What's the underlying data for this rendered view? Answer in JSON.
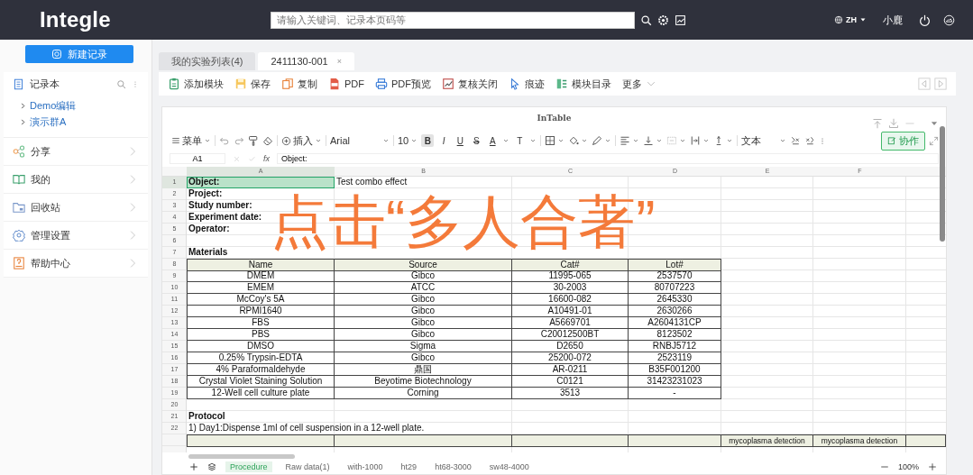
{
  "header": {
    "logo": "Integle",
    "search": {
      "placeholder": "请输入关键词、记录本页码等"
    },
    "language": "ZH",
    "user": "小鹿"
  },
  "sidebar": {
    "new_button": "新建记录",
    "notebook": {
      "title": "记录本",
      "children": [
        {
          "label": "Demo编辑",
          "expanded": false
        },
        {
          "label": "演示群A",
          "expanded": false
        }
      ]
    },
    "items": [
      {
        "label": "分享"
      },
      {
        "label": "我的"
      },
      {
        "label": "回收站"
      },
      {
        "label": "管理设置"
      },
      {
        "label": "帮助中心"
      }
    ]
  },
  "tabs": [
    {
      "label": "我的实验列表(4)",
      "selected": false
    },
    {
      "label": "2411130-001",
      "selected": true,
      "close": "×"
    }
  ],
  "toolbar": {
    "items": [
      "添加模块",
      "保存",
      "复制",
      "PDF",
      "PDF预览",
      "复核关闭",
      "痕迹",
      "模块目录"
    ],
    "more": "更多"
  },
  "sheet": {
    "title": "InTable",
    "menu": "菜单",
    "insert": "插入",
    "font": "Arial",
    "size": "10",
    "format_buttons": [
      {
        "label": "B",
        "kind": "bold",
        "selected": true
      },
      {
        "label": "I",
        "kind": "italic",
        "selected": false
      },
      {
        "label": "U",
        "kind": "underline",
        "selected": false
      },
      {
        "label": "S",
        "kind": "strike",
        "selected": false
      },
      {
        "label": "A",
        "kind": "color",
        "selected": false
      },
      {
        "label": "T",
        "kind": "size",
        "selected": false
      }
    ],
    "number_format": "文本",
    "collaborate": "协作",
    "name_box": "A1",
    "fx": "fx",
    "formula": "Object:",
    "columns": [
      {
        "label": "A",
        "selected": true
      },
      {
        "label": "B",
        "selected": false
      },
      {
        "label": "C",
        "selected": false
      },
      {
        "label": "D",
        "selected": false
      },
      {
        "label": "E",
        "selected": false
      },
      {
        "label": "F",
        "selected": false
      }
    ],
    "rows": [
      {
        "number": "1",
        "kind": "field",
        "selected": true,
        "cells": {
          "a": "Object:",
          "b": "Test combo effect"
        }
      },
      {
        "number": "2",
        "kind": "field",
        "selected": false,
        "cells": {
          "a": "Project:"
        }
      },
      {
        "number": "3",
        "kind": "field",
        "selected": false,
        "cells": {
          "a": "Study number:"
        }
      },
      {
        "number": "4",
        "kind": "field",
        "selected": false,
        "cells": {
          "a": "Experiment date:"
        }
      },
      {
        "number": "5",
        "kind": "field",
        "selected": false,
        "cells": {
          "a": "Operator:"
        }
      },
      {
        "number": "6",
        "kind": "blank",
        "selected": false
      },
      {
        "number": "7",
        "kind": "section",
        "selected": false,
        "cells": {
          "a": "Materials"
        }
      },
      {
        "number": "8",
        "kind": "header",
        "selected": false,
        "cells": {
          "a": "Name",
          "b": "Source",
          "c": "Cat#",
          "d": "Lot#"
        }
      },
      {
        "number": "9",
        "kind": "table",
        "selected": false,
        "cells": {
          "a": "DMEM",
          "b": "Gibco",
          "c": "11995-065",
          "d": "2537570"
        }
      },
      {
        "number": "10",
        "kind": "table",
        "selected": false,
        "cells": {
          "a": "EMEM",
          "b": "ATCC",
          "c": "30-2003",
          "d": "80707223"
        }
      },
      {
        "number": "11",
        "kind": "table",
        "selected": false,
        "cells": {
          "a": "McCoy's 5A",
          "b": "Gibco",
          "c": "16600-082",
          "d": "2645330"
        }
      },
      {
        "number": "12",
        "kind": "table",
        "selected": false,
        "cells": {
          "a": "RPMI1640",
          "b": "Gibco",
          "c": "A10491-01",
          "d": "2630266"
        }
      },
      {
        "number": "13",
        "kind": "table",
        "selected": false,
        "cells": {
          "a": "FBS",
          "b": "Gibco",
          "c": "A5669701",
          "d": "A2604131CP"
        }
      },
      {
        "number": "14",
        "kind": "table",
        "selected": false,
        "cells": {
          "a": "PBS",
          "b": "Gibco",
          "c": "C20012500BT",
          "d": "8123502"
        }
      },
      {
        "number": "15",
        "kind": "table",
        "selected": false,
        "cells": {
          "a": "DMSO",
          "b": "Sigma",
          "c": "D2650",
          "d": "RNBJ5712"
        }
      },
      {
        "number": "16",
        "kind": "table",
        "selected": false,
        "cells": {
          "a": "0.25% Trypsin-EDTA",
          "b": "Gibco",
          "c": "25200-072",
          "d": "2523119"
        }
      },
      {
        "number": "17",
        "kind": "table",
        "selected": false,
        "cells": {
          "a": "4% Paraformaldehyde",
          "b": "鼎国",
          "c": "AR-0211",
          "d": "B35F001200"
        }
      },
      {
        "number": "18",
        "kind": "table",
        "selected": false,
        "cells": {
          "a": "Crystal Violet Staining Solution",
          "b": "Beyotime Biotechnology",
          "c": "C0121",
          "d": "31423231023"
        }
      },
      {
        "number": "19",
        "kind": "table",
        "selected": false,
        "cells": {
          "a": "12-Well cell culture plate",
          "b": "Corning",
          "c": "3513",
          "d": "-"
        }
      },
      {
        "number": "20",
        "kind": "blank",
        "selected": false
      },
      {
        "number": "21",
        "kind": "section",
        "selected": false,
        "cells": {
          "a": "Protocol"
        }
      },
      {
        "number": "22",
        "kind": "text",
        "selected": false,
        "cells": {
          "a": "1) Day1:Dispense 1ml of cell suspension in a 12-well plate."
        }
      },
      {
        "kind": "header",
        "selected": false,
        "cells": {
          "e": "mycoplasma detection",
          "f": "mycoplasma detection"
        }
      }
    ],
    "sheets": [
      {
        "label": "Procedure",
        "selected": true
      },
      {
        "label": "Raw data(1)",
        "selected": false
      },
      {
        "label": "with-1000",
        "selected": false
      },
      {
        "label": "ht29",
        "selected": false
      },
      {
        "label": "ht68-3000",
        "selected": false
      },
      {
        "label": "sw48-4000",
        "selected": false
      }
    ],
    "zoom": "100%"
  },
  "overlay": "点击“多人合著”"
}
